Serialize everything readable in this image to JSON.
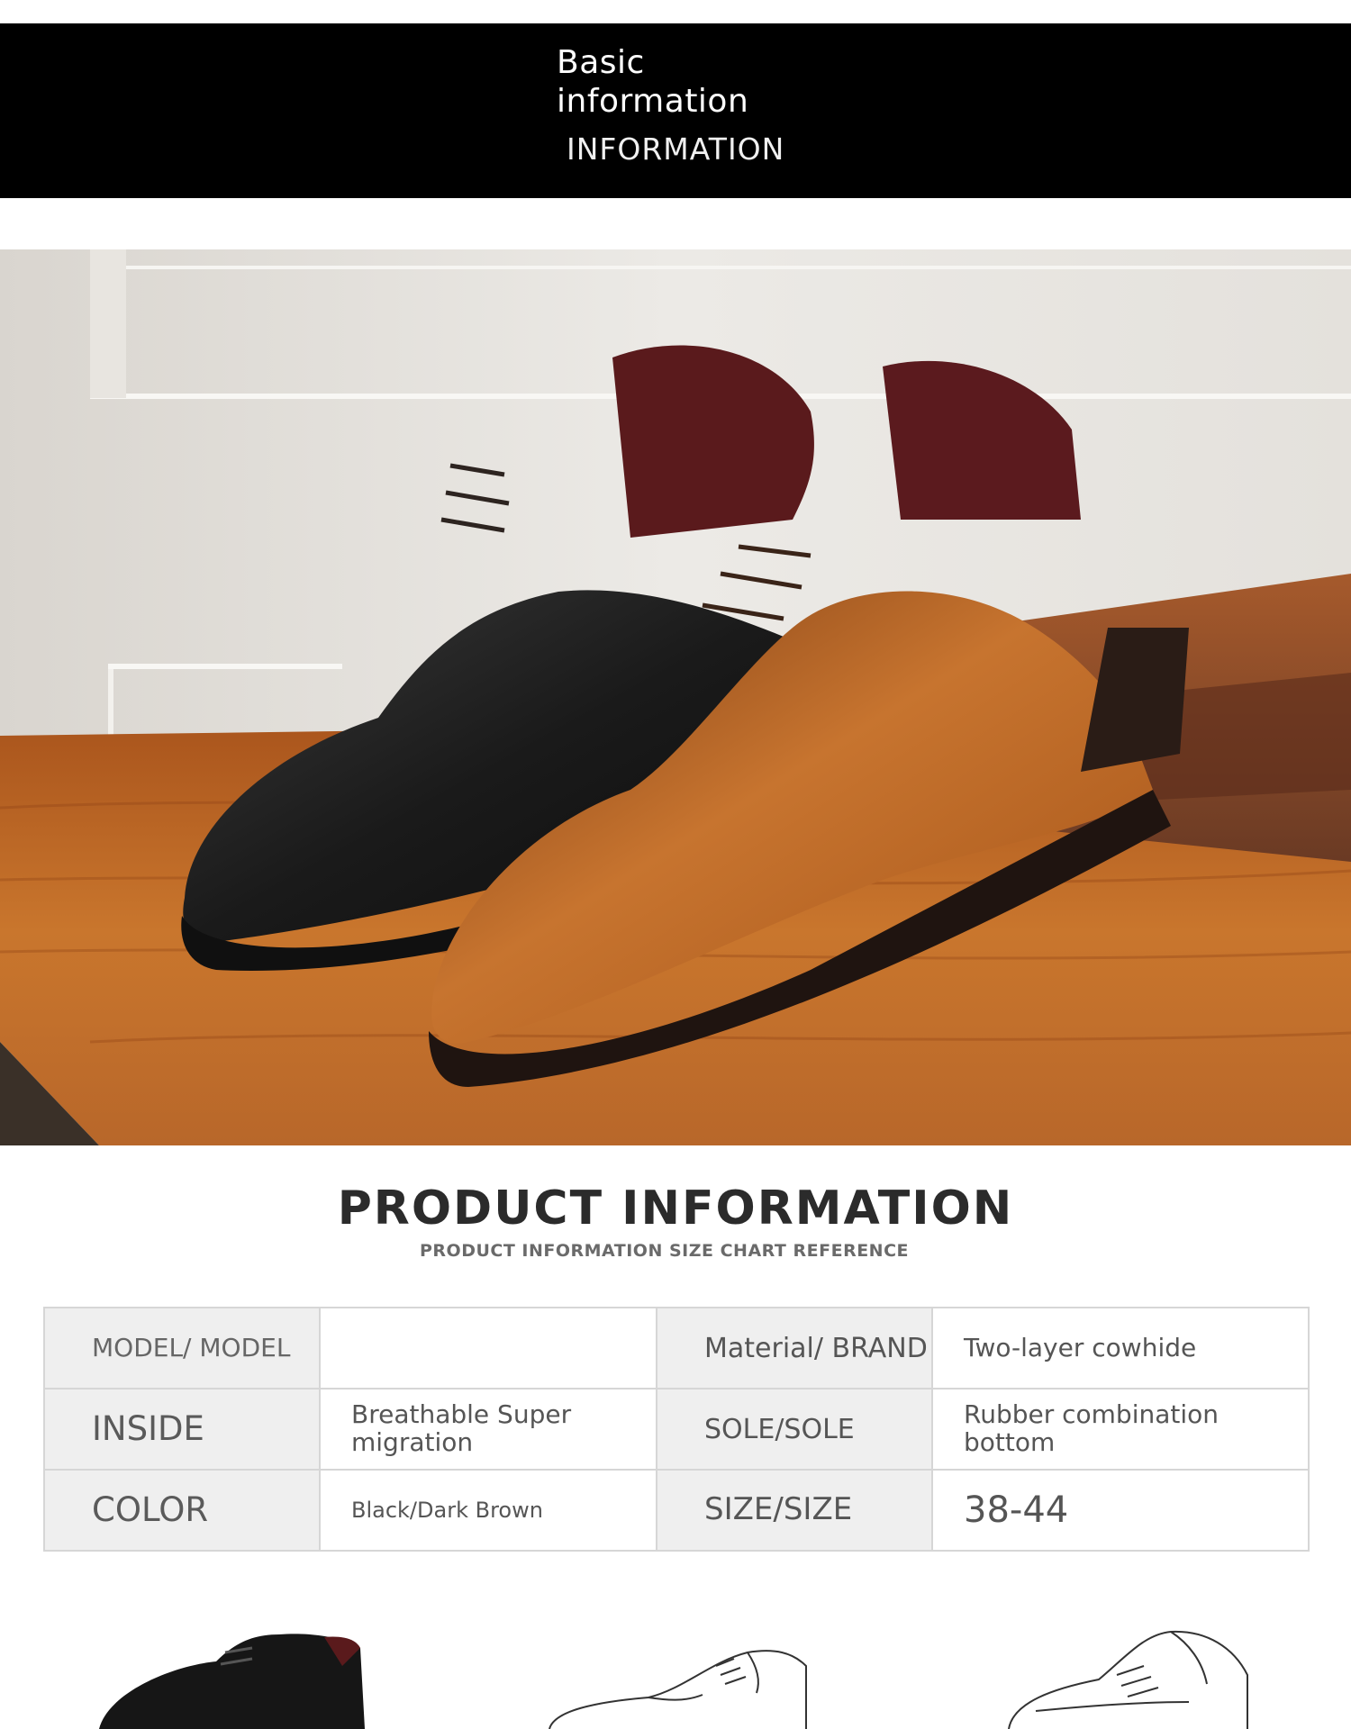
{
  "header": {
    "title": "Basic information",
    "subtitle": "INFORMATION"
  },
  "hero": {
    "icon": "dress-shoes-photo",
    "shoe_colors": [
      "#1c1c1c",
      "#b8621f"
    ]
  },
  "product_info": {
    "title": "PRODUCT INFORMATION",
    "subtitle": "PRODUCT INFORMATION SIZE CHART REFERENCE",
    "rows": [
      {
        "label1": "MODEL/ MODEL",
        "value1": "",
        "label2": "Material/ BRAND",
        "value2": "Two-layer cowhide"
      },
      {
        "label1": "INSIDE",
        "value1": "Breathable Super migration",
        "label2": "SOLE/SOLE",
        "value2": "Rubber combination bottom"
      },
      {
        "label1": "COLOR",
        "value1": "Black/Dark Brown",
        "label2": "SIZE/SIZE",
        "value2": "38-44"
      }
    ]
  },
  "thumbnails": [
    {
      "icon": "black-shoe-photo"
    },
    {
      "icon": "shoe-side-sketch-icon"
    },
    {
      "icon": "shoe-top-sketch-icon"
    }
  ]
}
